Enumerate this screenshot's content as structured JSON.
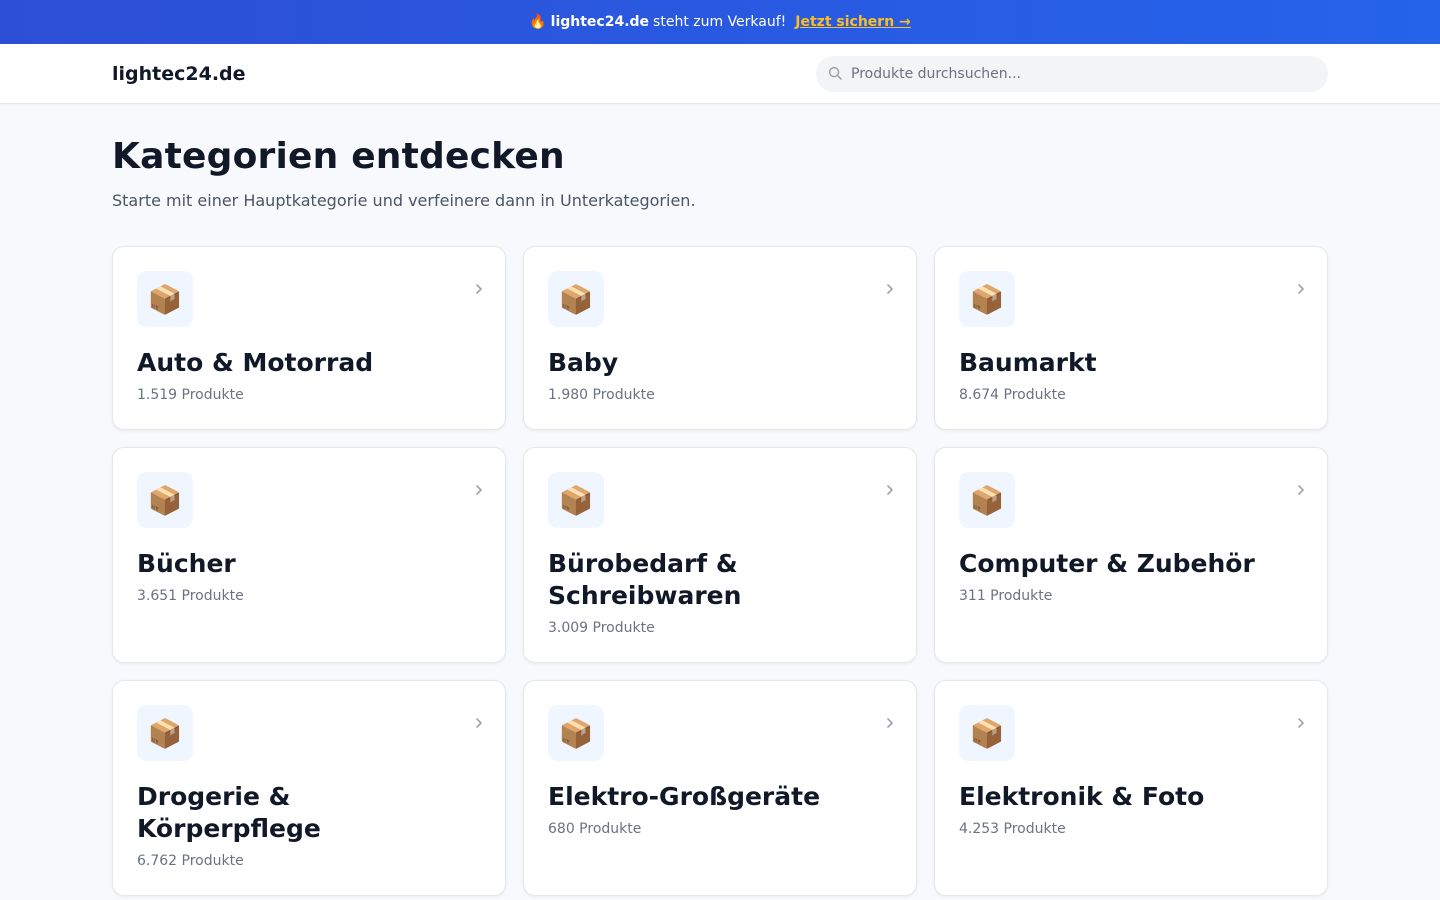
{
  "banner": {
    "glyph": "🔥",
    "domain": "lightec24.de",
    "message": "steht zum Verkauf!",
    "cta": "Jetzt sichern →"
  },
  "header": {
    "logo": "lightec24.de",
    "search_placeholder": "Produkte durchsuchen..."
  },
  "page": {
    "title": "Kategorien entdecken",
    "subtitle": "Starte mit einer Hauptkategorie und verfeinere dann in Unterkategorien."
  },
  "categories": [
    {
      "icon": "📦",
      "icon_name": "car-icon",
      "name": "Auto & Motorrad",
      "count": "1.519 Produkte"
    },
    {
      "icon": "📦",
      "icon_name": "baby-icon",
      "name": "Baby",
      "count": "1.980 Produkte"
    },
    {
      "icon": "📦",
      "icon_name": "tools-icon",
      "name": "Baumarkt",
      "count": "8.674 Produkte"
    },
    {
      "icon": "📦",
      "icon_name": "book-icon",
      "name": "Bücher",
      "count": "3.651 Produkte"
    },
    {
      "icon": "📦",
      "icon_name": "paperclip-icon",
      "name": "Bürobedarf & Schreibwaren",
      "count": "3.009 Produkte"
    },
    {
      "icon": "📦",
      "icon_name": "computer-icon",
      "name": "Computer & Zubehör",
      "count": "311 Produkte"
    },
    {
      "icon": "📦",
      "icon_name": "lotion-icon",
      "name": "Drogerie & Körperpflege",
      "count": "6.762 Produkte"
    },
    {
      "icon": "📦",
      "icon_name": "appliance-icon",
      "name": "Elektro-Großgeräte",
      "count": "680 Produkte"
    },
    {
      "icon": "📦",
      "icon_name": "camera-icon",
      "name": "Elektronik & Foto",
      "count": "4.253 Produkte"
    }
  ]
}
